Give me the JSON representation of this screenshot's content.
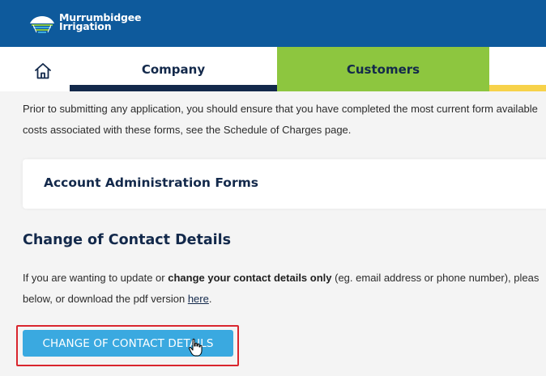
{
  "brand": {
    "line1": "Murrumbidgee",
    "line2": "Irrigation",
    "header_color": "#0e5a9c",
    "logo_icon": "murrumbidgee-logo-icon"
  },
  "nav": {
    "home_icon": "home-icon",
    "tabs": [
      {
        "label": "Company",
        "accent": "#13294b"
      },
      {
        "label": "Customers",
        "accent": "#8dc63f"
      },
      {
        "label": "",
        "accent": "#f7d24a"
      }
    ]
  },
  "content": {
    "intro_line1": "Prior to submitting any application, you should ensure that you have completed the most current form available",
    "intro_line2": "costs associated with these forms, see the Schedule of Charges page.",
    "accordion_title": "Account Administration Forms",
    "section_title": "Change of Contact Details",
    "para_pre": "If you are wanting to update or ",
    "para_bold": "change your contact details only",
    "para_post": " (eg. email address or phone number), pleas",
    "para_line2_pre": "below, or download the pdf version ",
    "para_link": "here",
    "para_line2_post": ".",
    "cta_label": "CHANGE OF CONTACT DETAILS",
    "cta_color": "#3aa9e0",
    "highlight_color": "#d9262e"
  }
}
